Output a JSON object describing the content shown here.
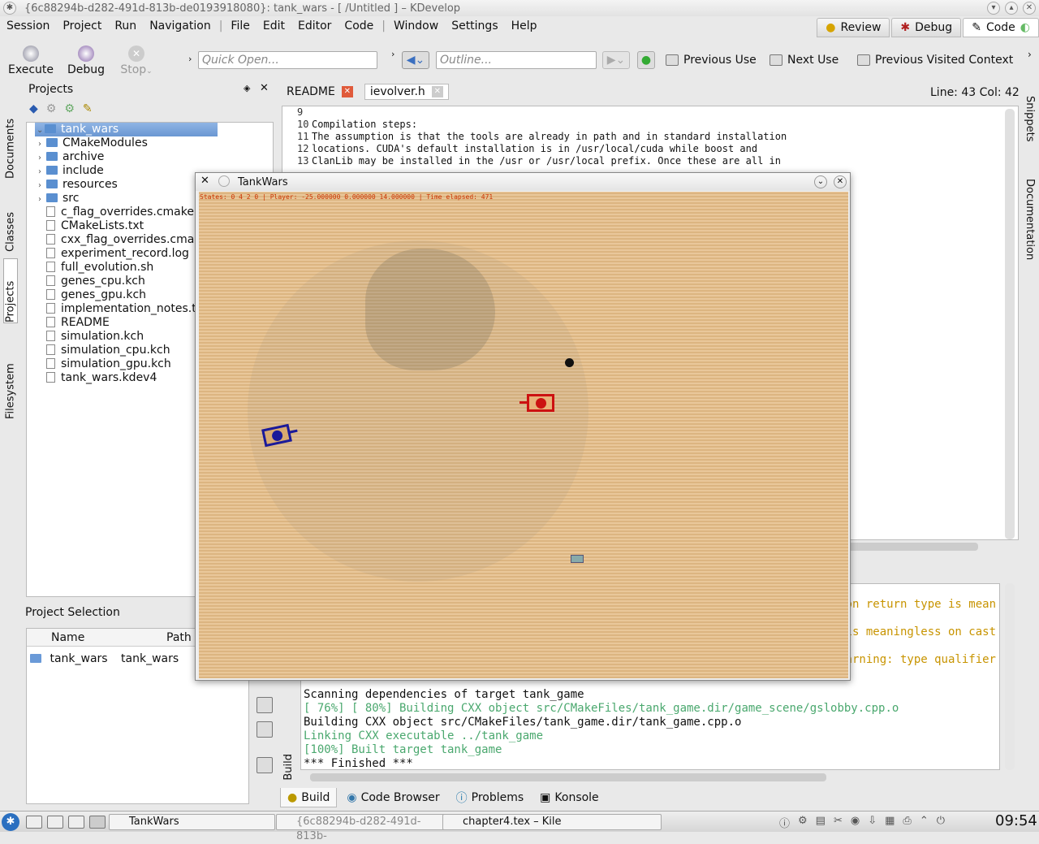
{
  "window": {
    "title": "{6c88294b-d282-491d-813b-de0193918080}: tank_wars - [ /Untitled ] – KDevelop"
  },
  "menu": [
    "Session",
    "Project",
    "Run",
    "Navigation",
    "File",
    "Edit",
    "Editor",
    "Code",
    "Window",
    "Settings",
    "Help"
  ],
  "areas": [
    "Review",
    "Debug",
    "Code"
  ],
  "toolbar": {
    "execute": "Execute",
    "debug": "Debug",
    "stop": "Stop",
    "quick_open": "Quick Open...",
    "outline": "Outline...",
    "previous_use": "Previous Use",
    "next_use": "Next Use",
    "previous_context": "Previous Visited Context"
  },
  "left_tabs": [
    "Documents",
    "Classes",
    "Projects",
    "Filesystem"
  ],
  "right_tabs": [
    "Snippets",
    "Documentation"
  ],
  "projects": {
    "title": "Projects",
    "items": [
      {
        "name": "tank_wars",
        "type": "project",
        "level": 0
      },
      {
        "name": "CMakeModules",
        "type": "folder",
        "level": 1
      },
      {
        "name": "archive",
        "type": "folder",
        "level": 1
      },
      {
        "name": "include",
        "type": "folder",
        "level": 1
      },
      {
        "name": "resources",
        "type": "folder",
        "level": 1
      },
      {
        "name": "src",
        "type": "folder",
        "level": 1
      },
      {
        "name": "c_flag_overrides.cmake",
        "type": "file",
        "level": 1
      },
      {
        "name": "CMakeLists.txt",
        "type": "file",
        "level": 1
      },
      {
        "name": "cxx_flag_overrides.cmak",
        "type": "file",
        "level": 1
      },
      {
        "name": "experiment_record.log",
        "type": "file",
        "level": 1
      },
      {
        "name": "full_evolution.sh",
        "type": "file",
        "level": 1
      },
      {
        "name": "genes_cpu.kch",
        "type": "file",
        "level": 1
      },
      {
        "name": "genes_gpu.kch",
        "type": "file",
        "level": 1
      },
      {
        "name": "implementation_notes.t",
        "type": "file",
        "level": 1
      },
      {
        "name": "README",
        "type": "file",
        "level": 1
      },
      {
        "name": "simulation.kch",
        "type": "file",
        "level": 1
      },
      {
        "name": "simulation_cpu.kch",
        "type": "file",
        "level": 1
      },
      {
        "name": "simulation_gpu.kch",
        "type": "file",
        "level": 1
      },
      {
        "name": "tank_wars.kdev4",
        "type": "file",
        "level": 1
      }
    ]
  },
  "project_selection": {
    "title": "Project Selection",
    "col_name": "Name",
    "col_path": "Path",
    "row_name": "tank_wars",
    "row_path": "tank_wars"
  },
  "editor": {
    "tabs": [
      "README",
      "ievolver.h"
    ],
    "position": "Line: 43 Col: 42",
    "lines": [
      {
        "n": "9",
        "t": ""
      },
      {
        "n": "10",
        "t": "Compilation steps:"
      },
      {
        "n": "11",
        "t": "The assumption is that the tools are already in path and in standard installation"
      },
      {
        "n": "12",
        "t": "locations. CUDA's default installation is in /usr/local/cuda while boost and"
      },
      {
        "n": "13",
        "t": "ClanLib may be installed in the /usr or /usr/local prefix. Once these are all in"
      }
    ]
  },
  "build": {
    "right_fragments": [
      "r on return type is mean",
      "r is meaningless on cast",
      "warning: type qualifier"
    ],
    "lines": [
      {
        "t": "Scanning dependencies of target tank_game",
        "c": "#111"
      },
      {
        "t": "[ 76%] [ 80%] Building CXX object src/CMakeFiles/tank_game.dir/game_scene/gslobby.cpp.o",
        "c": "#4aa86e"
      },
      {
        "t": "Building CXX object src/CMakeFiles/tank_game.dir/tank_game.cpp.o",
        "c": "#111"
      },
      {
        "t": "Linking CXX executable ../tank_game",
        "c": "#4aa86e"
      },
      {
        "t": "[100%] Built target tank_game",
        "c": "#4aa86e"
      },
      {
        "t": "*** Finished ***",
        "c": "#111"
      }
    ],
    "side_label": "Build"
  },
  "bottom_tabs": [
    "Build",
    "Code Browser",
    "Problems",
    "Konsole"
  ],
  "dialog": {
    "title": "TankWars",
    "status": "States: 0 4 2 0 | Player: -25.000000 0.000000 14.000000 | Time elapsed: 471"
  },
  "taskbar": {
    "tasks": [
      "TankWars",
      "{6c88294b-d282-491d-813b-",
      "chapter4.tex – Kile"
    ],
    "clock": "09:54"
  },
  "colors": {
    "red_tank": "#cc1111",
    "blue_tank": "#1a1a9a",
    "sand": "#e2bd8b",
    "status_text": "#cc3300"
  }
}
